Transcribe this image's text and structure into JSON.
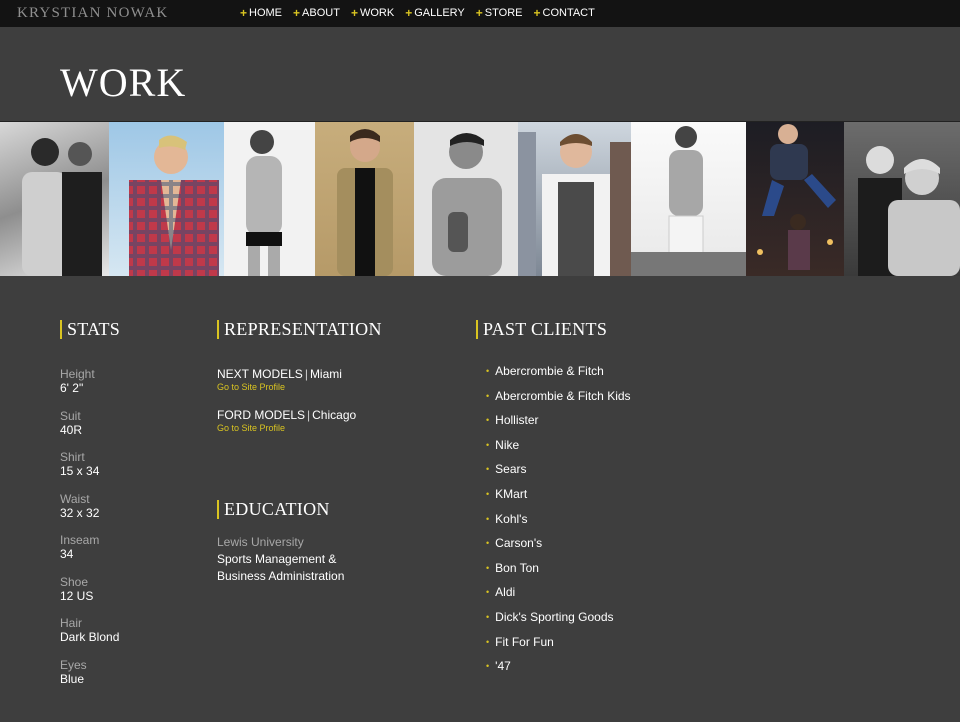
{
  "header": {
    "brand": "KRYSTIAN NOWAK",
    "nav": [
      {
        "label": "HOME"
      },
      {
        "label": "ABOUT"
      },
      {
        "label": "WORK"
      },
      {
        "label": "GALLERY"
      },
      {
        "label": "STORE"
      },
      {
        "label": "CONTACT"
      }
    ]
  },
  "page": {
    "title": "WORK"
  },
  "stats": {
    "heading": "STATS",
    "items": [
      {
        "label": "Height",
        "value": "6' 2\""
      },
      {
        "label": "Suit",
        "value": "40R"
      },
      {
        "label": "Shirt",
        "value": "15 x 34"
      },
      {
        "label": "Waist",
        "value": "32 x 32"
      },
      {
        "label": "Inseam",
        "value": "34"
      },
      {
        "label": "Shoe",
        "value": "12 US"
      },
      {
        "label": "Hair",
        "value": "Dark Blond"
      },
      {
        "label": "Eyes",
        "value": "Blue"
      }
    ]
  },
  "representation": {
    "heading": "REPRESENTATION",
    "agencies": [
      {
        "name": "NEXT MODELS",
        "separator": "|",
        "city": "Miami",
        "link": "Go to Site Profile"
      },
      {
        "name": "FORD MODELS",
        "separator": "|",
        "city": "Chicago",
        "link": "Go to Site Profile"
      }
    ]
  },
  "education": {
    "heading": "EDUCATION",
    "school": "Lewis University",
    "lines": [
      "Sports Management &",
      "Business Administration"
    ]
  },
  "clients": {
    "heading": "PAST CLIENTS",
    "items": [
      "Abercrombie & Fitch",
      "Abercrombie & Fitch Kids",
      "Hollister",
      "Nike",
      "Sears",
      "KMart",
      "Kohl's",
      "Carson's",
      "Bon Ton",
      "Aldi",
      "Dick's Sporting Goods",
      "Fit For Fun",
      "'47"
    ]
  },
  "colors": {
    "accent": "#d9c421",
    "background": "#3e3e3e",
    "topbar": "#131313"
  }
}
